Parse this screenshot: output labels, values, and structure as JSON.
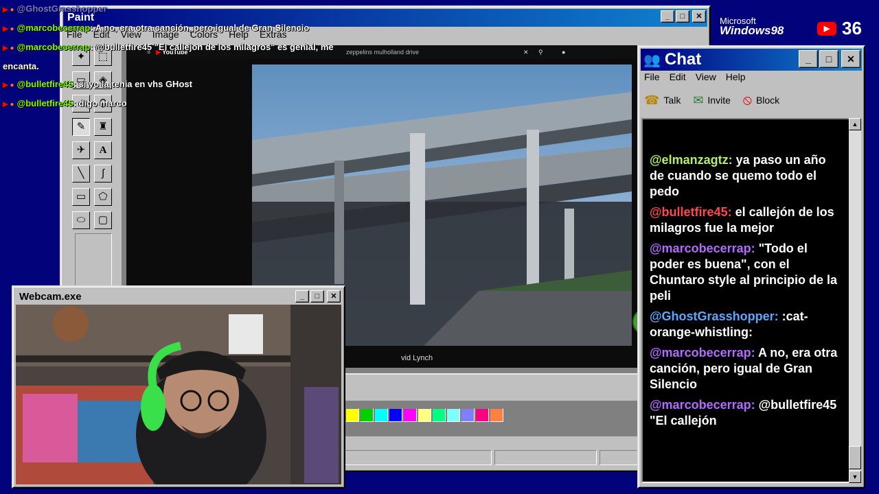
{
  "paint": {
    "title": "Paint",
    "menu": [
      "File",
      "Edit",
      "View",
      "Image",
      "Colors",
      "Help",
      "Extras"
    ]
  },
  "youtube": {
    "logo": "YouTube",
    "search_text": "zeppelins mulholland drive",
    "caption": "vid Lynch"
  },
  "palette_colors": [
    "#ffff00",
    "#00d000",
    "#00ffff",
    "#0000ff",
    "#ff00ff",
    "#ffff80",
    "#00ff80",
    "#80ffff",
    "#8080ff",
    "#ff0080",
    "#ff8040"
  ],
  "webcam": {
    "title": "Webcam.exe"
  },
  "chat": {
    "title": "Chat",
    "menu": [
      "File",
      "Edit",
      "View",
      "Help"
    ],
    "tools": [
      "Talk",
      "Invite",
      "Block"
    ],
    "messages": [
      {
        "user": "@elmanzagtz:",
        "text": " ya paso un año de cuando se quemo todo el pedo",
        "color": "#b3f06a"
      },
      {
        "user": "@bulletfire45:",
        "text": " el callejón de los milagros fue la mejor",
        "color": "#ff4a4a"
      },
      {
        "user": "@marcobecerrap:",
        "text": " \"Todo el poder es buena\", con el Chuntaro style al principio de la peli",
        "color": "#b36bff"
      },
      {
        "user": "@GhostGrasshopper:",
        "text": " :cat-orange-whistling:",
        "color": "#5aa8ff"
      },
      {
        "user": "@marcobecerrap:",
        "text": " A no, era otra canción, pero igual de Gran Silencio",
        "color": "#b36bff"
      },
      {
        "user": "@marcobecerrap:",
        "text": " @bulletfire45 \"El callejón",
        "color": "#b36bff"
      }
    ]
  },
  "overlay": [
    {
      "user": "@GhostGrasshopper",
      "text": "",
      "faded": true
    },
    {
      "user": "@marcobecerrap",
      "text": ": A no, era otra canción, pero igual de Gran Silencio",
      "faded": false
    },
    {
      "user": "@marcobecerrap",
      "text": ": @bulletfire45 \"El callejon de los milagros\" es genial, me",
      "faded": false
    },
    {
      "user": "",
      "text": "encanta.",
      "faded": false
    },
    {
      "user": "@bulletfire45",
      "text": ": si yo la tenia en vhs GHost",
      "faded": false
    },
    {
      "user": "@bulletfire45",
      "text": ": digo marco",
      "faded": false
    }
  ],
  "branding": {
    "ms_line1": "Microsoft",
    "ms_line2": "Windows98",
    "viewer_count": "36"
  }
}
